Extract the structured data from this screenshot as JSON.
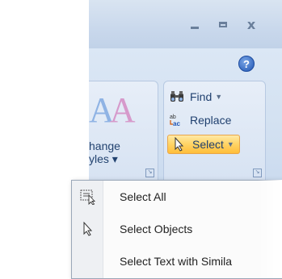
{
  "window": {
    "minimize_icon": "minimize-icon",
    "maximize_icon": "maximize-icon",
    "close_icon": "close-icon",
    "close_glyph": "x"
  },
  "ribbon": {
    "help_glyph": "?",
    "styles_group": {
      "aa_text": "AA",
      "change_styles_line1": "hange",
      "change_styles_line2": "yles ▾"
    },
    "editing_group": {
      "find_label": "Find",
      "replace_label": "Replace",
      "select_label": "Select"
    }
  },
  "select_menu": {
    "items": [
      {
        "label": "Select All",
        "icon": "select-all-icon"
      },
      {
        "label": "Select Objects",
        "icon": "cursor-arrow-icon"
      },
      {
        "label": "Select Text with Simila",
        "icon": ""
      }
    ]
  },
  "colors": {
    "ribbon_bg": "#d3e1f1",
    "select_highlight": "#ffd569",
    "text_blue": "#1f3f6e"
  }
}
